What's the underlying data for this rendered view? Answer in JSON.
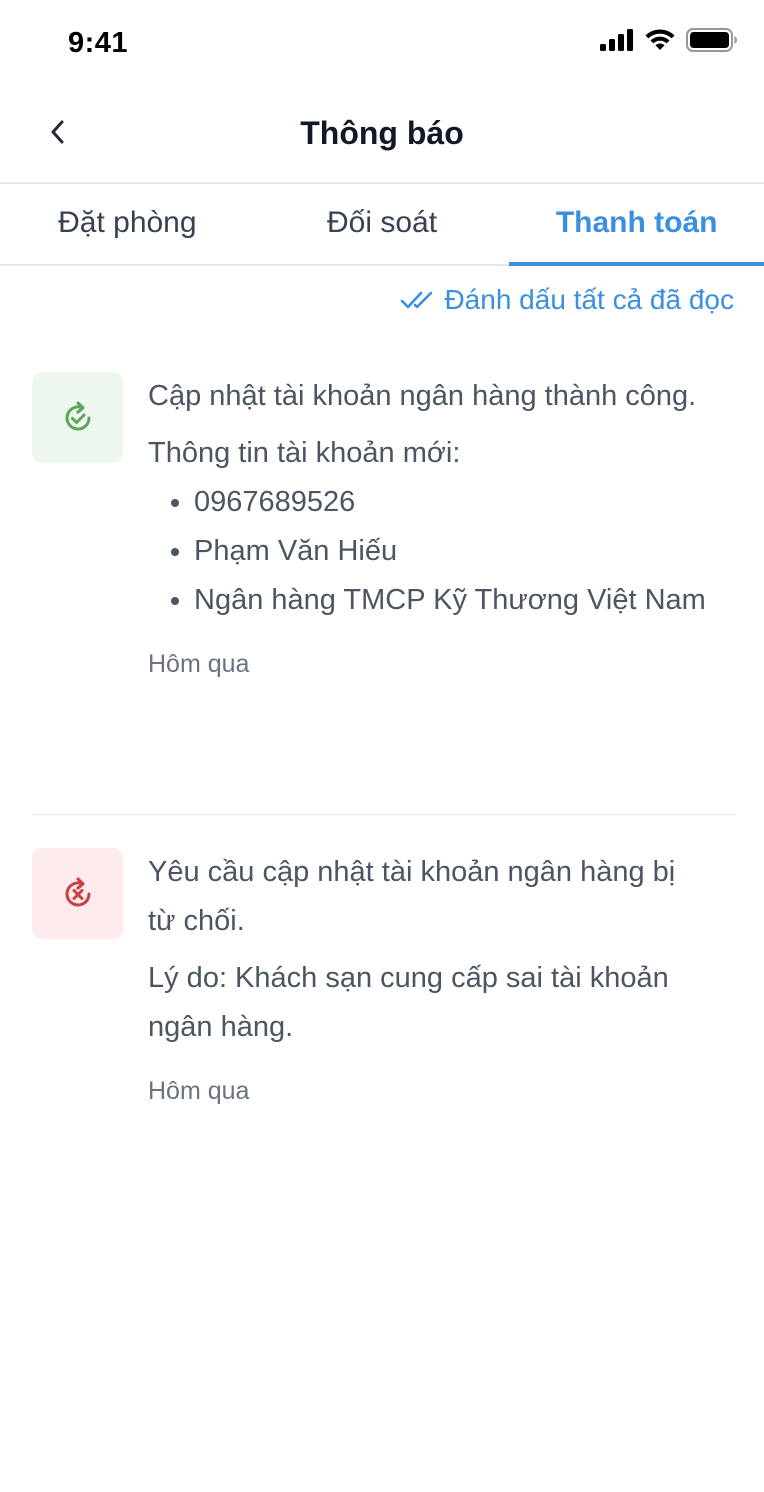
{
  "status_bar": {
    "time": "9:41"
  },
  "header": {
    "title": "Thông báo"
  },
  "tabs": [
    {
      "label": "Đặt phòng",
      "active": false
    },
    {
      "label": "Đối soát",
      "active": false
    },
    {
      "label": "Thanh toán",
      "active": true
    }
  ],
  "mark_all_read": {
    "label": "Đánh dấu tất cả đã đọc",
    "icon": "double-check-icon"
  },
  "notifications": [
    {
      "status": "success",
      "icon": "refresh-check-icon",
      "title": "Cập nhật tài khoản ngân hàng thành công.",
      "subtitle": "Thông tin tài khoản mới:",
      "details": [
        "0967689526",
        "Phạm Văn Hiếu",
        "Ngân hàng TMCP Kỹ Thương Việt Nam"
      ],
      "time": "Hôm qua"
    },
    {
      "status": "error",
      "icon": "refresh-x-icon",
      "title": "Yêu cầu cập nhật tài khoản ngân hàng bị từ chối.",
      "reason": "Lý do: Khách sạn cung cấp sai tài khoản ngân hàng.",
      "time": "Hôm qua"
    }
  ],
  "colors": {
    "accent": "#3b8fe0",
    "success": "#5aa65a",
    "success_bg": "#eef7ee",
    "error": "#c9403f",
    "error_bg": "#fdebee"
  }
}
